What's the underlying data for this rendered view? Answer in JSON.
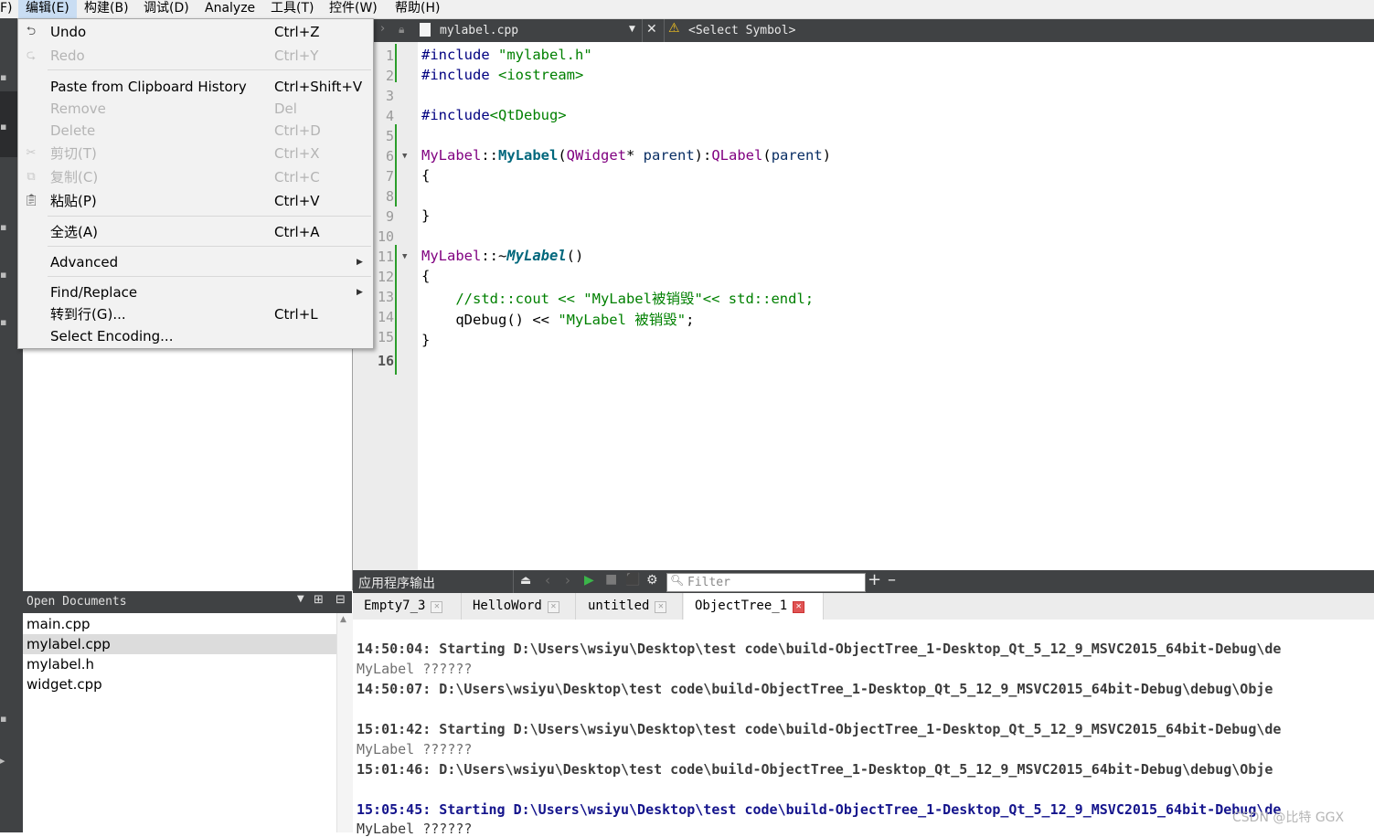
{
  "menubar": {
    "items": [
      "F)",
      "编辑(E)",
      "构建(B)",
      "调试(D)",
      "Analyze",
      "工具(T)",
      "控件(W)",
      "帮助(H)"
    ]
  },
  "editor": {
    "file_name": "mylabel.cpp",
    "symbol": "<Select Symbol>",
    "line_numbers": [
      "1",
      "2",
      "3",
      "4",
      "5",
      "6",
      "7",
      "8",
      "9",
      "10",
      "11",
      "12",
      "13",
      "14",
      "15",
      "16"
    ],
    "code": {
      "l1_a": "#include ",
      "l1_b": "\"mylabel.h\"",
      "l2_a": "#include ",
      "l2_b": "<iostream>",
      "l4_a": "#include",
      "l4_b": "<QtDebug>",
      "l6_a": "MyLabel",
      "l6_b": "::",
      "l6_c": "MyLabel",
      "l6_d": "(",
      "l6_e": "QWidget",
      "l6_f": "* ",
      "l6_g": "parent",
      "l6_h": "):",
      "l6_i": "QLabel",
      "l6_j": "(",
      "l6_k": "parent",
      "l6_l": ")",
      "l7": "{",
      "l9": "}",
      "l11_a": "MyLabel",
      "l11_b": "::~",
      "l11_c": "MyLabel",
      "l11_d": "()",
      "l12": "{",
      "l13": "    //std::cout << \"MyLabel被销毁\"<< std::endl;",
      "l14_a": "    qDebug() << ",
      "l14_b": "\"MyLabel 被销毁\"",
      "l14_c": ";",
      "l15": "}"
    }
  },
  "popup_menu": {
    "items": [
      {
        "label": "Undo",
        "shortcut": "Ctrl+Z",
        "icon": "undo-icon"
      },
      {
        "label": "Redo",
        "shortcut": "Ctrl+Y",
        "icon": "redo-icon"
      },
      {
        "label": "Paste from Clipboard History",
        "shortcut": "Ctrl+Shift+V"
      },
      {
        "label": "Remove",
        "shortcut": "Del"
      },
      {
        "label": "Delete",
        "shortcut": "Ctrl+D"
      },
      {
        "label": "剪切(T)",
        "shortcut": "Ctrl+X",
        "icon": "cut-icon"
      },
      {
        "label": "复制(C)",
        "shortcut": "Ctrl+C",
        "icon": "copy-icon"
      },
      {
        "label": "粘贴(P)",
        "shortcut": "Ctrl+V",
        "icon": "paste-icon"
      },
      {
        "label": "全选(A)",
        "shortcut": "Ctrl+A"
      },
      {
        "label": "Advanced",
        "shortcut": ""
      },
      {
        "label": "Find/Replace",
        "shortcut": ""
      },
      {
        "label": "转到行(G)...",
        "shortcut": "Ctrl+L"
      },
      {
        "label": "Select Encoding...",
        "shortcut": ""
      }
    ]
  },
  "open_documents": {
    "title": "Open Documents",
    "files": [
      "main.cpp",
      "mylabel.cpp",
      "mylabel.h",
      "widget.cpp"
    ]
  },
  "output": {
    "title": "应用程序输出",
    "filter_placeholder": "Filter",
    "tabs": [
      "Empty7_3",
      "HelloWord",
      "untitled",
      "ObjectTree_1"
    ],
    "lines": [
      "14:50:04: Starting D:\\Users\\wsiyu\\Desktop\\test code\\build-ObjectTree_1-Desktop_Qt_5_12_9_MSVC2015_64bit-Debug\\de",
      "MyLabel ??????",
      "14:50:07: D:\\Users\\wsiyu\\Desktop\\test code\\build-ObjectTree_1-Desktop_Qt_5_12_9_MSVC2015_64bit-Debug\\debug\\Obje",
      "15:01:42: Starting D:\\Users\\wsiyu\\Desktop\\test code\\build-ObjectTree_1-Desktop_Qt_5_12_9_MSVC2015_64bit-Debug\\de",
      "MyLabel ??????",
      "15:01:46: D:\\Users\\wsiyu\\Desktop\\test code\\build-ObjectTree_1-Desktop_Qt_5_12_9_MSVC2015_64bit-Debug\\debug\\Obje",
      "15:05:45: Starting D:\\Users\\wsiyu\\Desktop\\test code\\build-ObjectTree_1-Desktop_Qt_5_12_9_MSVC2015_64bit-Debug\\de",
      "MyLabel ??????"
    ]
  },
  "watermark": "CSDN @比特 GGX",
  "colors": {
    "menu_active": "#c9ddf3",
    "panel_dark": "#404244",
    "keyword": "#000080",
    "string": "#008000",
    "class": "#800080"
  }
}
